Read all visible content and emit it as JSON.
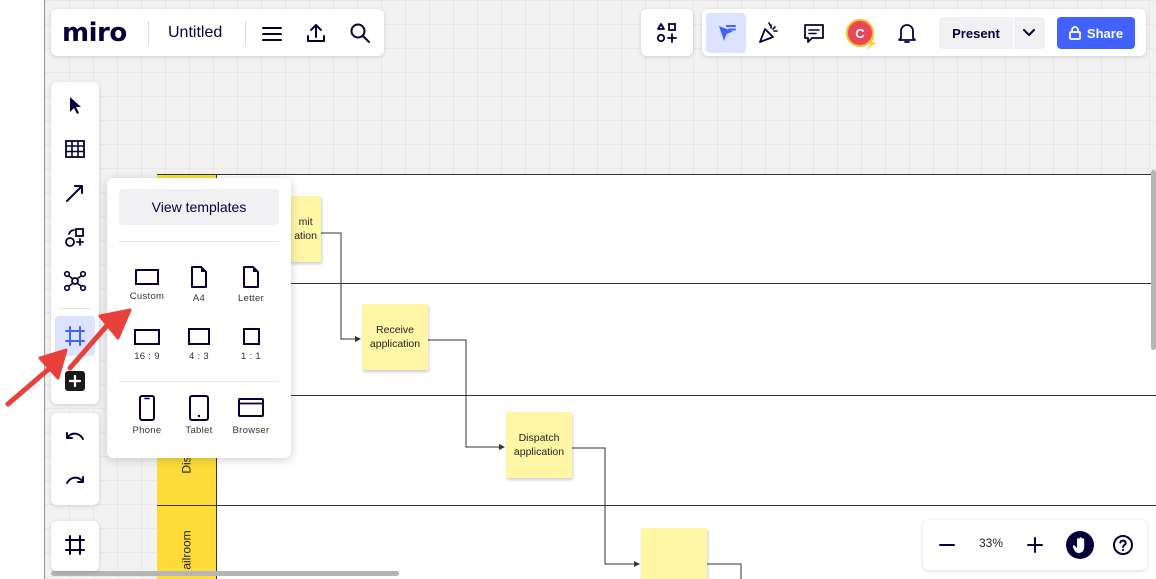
{
  "app": {
    "brand": "miro",
    "board_title": "Untitled"
  },
  "toolbar_right": {
    "present_label": "Present",
    "share_label": "Share",
    "avatar_initial": "C"
  },
  "frame_popup": {
    "view_templates_label": "View templates",
    "presets": [
      {
        "label": "Custom"
      },
      {
        "label": "A4"
      },
      {
        "label": "Letter"
      },
      {
        "label": "16 : 9"
      },
      {
        "label": "4 : 3"
      },
      {
        "label": "1 : 1"
      },
      {
        "label": "Phone"
      },
      {
        "label": "Tablet"
      },
      {
        "label": "Browser"
      }
    ]
  },
  "board": {
    "lanes": [
      {
        "label": ""
      },
      {
        "label": ""
      },
      {
        "label": "Dis"
      },
      {
        "label": "ailroom"
      }
    ],
    "stickies": [
      {
        "text": "mit\nation"
      },
      {
        "text": "Receive application"
      },
      {
        "text": "Dispatch application"
      },
      {
        "text": ""
      }
    ]
  },
  "zoom": {
    "level": "33%"
  },
  "colors": {
    "accent": "#4262ff",
    "active_tool_bg": "#dde3ff",
    "lane_yellow": "#fddc3a",
    "sticky_yellow": "#fff6a6",
    "annotation_arrow": "#e8403a"
  }
}
